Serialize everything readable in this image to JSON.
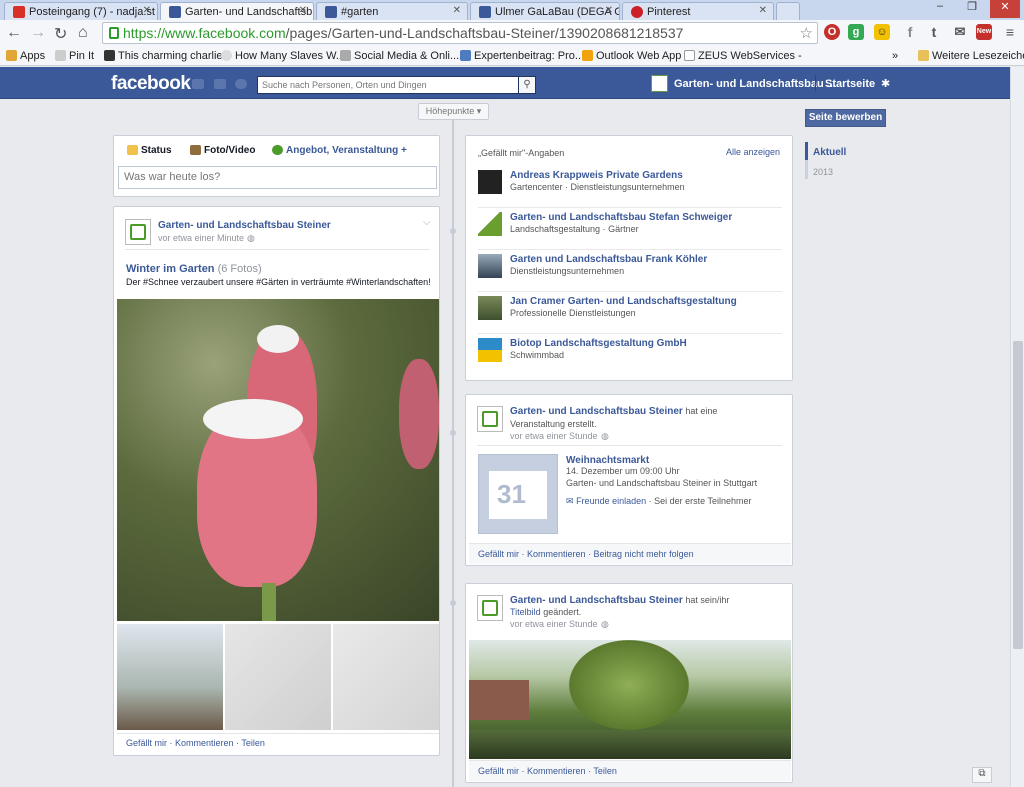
{
  "browser": {
    "tabs": [
      {
        "label": "Posteingang (7) - nadja.st",
        "icon": "gmail-icon",
        "color": "#d93025"
      },
      {
        "label": "Garten- und Landschaftsb",
        "icon": "facebook-icon",
        "color": "#3b5998"
      },
      {
        "label": "#garten",
        "icon": "facebook-icon",
        "color": "#3b5998"
      },
      {
        "label": "Ulmer GaLaBau (DEGA GA",
        "icon": "facebook-icon",
        "color": "#3b5998"
      },
      {
        "label": "Pinterest",
        "icon": "pinterest-icon",
        "color": "#cb2027"
      }
    ],
    "url_host": "https://www.facebook.com",
    "url_path": "/pages/Garten-und-Landschaftsbau-Steiner/1390208681218537",
    "bookmarks": [
      {
        "label": "Apps",
        "icon": "apps-icon"
      },
      {
        "label": "Pin It",
        "icon": "pinit-icon"
      },
      {
        "label": "This charming charlie",
        "icon": "page-icon"
      },
      {
        "label": "How Many Slaves W...",
        "icon": "page-icon"
      },
      {
        "label": "Social Media & Onli...",
        "icon": "page-icon"
      },
      {
        "label": "Expertenbeitrag: Pro...",
        "icon": "page-icon"
      },
      {
        "label": "Outlook Web App",
        "icon": "outlook-icon"
      },
      {
        "label": "ZEUS WebServices -",
        "icon": "page-icon"
      }
    ],
    "bookmarks_overflow": "»",
    "other_bookmarks": "Weitere Lesezeichen"
  },
  "fb": {
    "logo": "facebook",
    "search_placeholder": "Suche nach Personen, Orten und Dingen",
    "page_name": "Garten- und Landschaftsbau ...",
    "home": "Startseite",
    "highlights": "Höhepunkte ▾",
    "promote": "Seite bewerben",
    "years": {
      "current": "Aktuell",
      "year": "2013"
    }
  },
  "composer": {
    "tabs": [
      "Status",
      "Foto/Video",
      "Angebot, Veranstaltung +"
    ],
    "placeholder": "Was war heute los?"
  },
  "post1": {
    "author": "Garten- und Landschaftsbau Steiner",
    "time": "vor etwa einer Minute",
    "album_title": "Winter im Garten",
    "album_count": "(6 Fotos)",
    "caption": "Der #Schnee verzaubert unsere #Gärten in verträumte #Winterlandschaften!",
    "actions": [
      "Gefällt mir",
      "Kommentieren",
      "Teilen"
    ]
  },
  "likes": {
    "title": "„Gefällt mir\"-Angaben",
    "see_all": "Alle anzeigen",
    "items": [
      {
        "name": "Andreas Krappweis Private Gardens",
        "sub": "Gartencenter · Dienstleistungsunternehmen"
      },
      {
        "name": "Garten- und Landschaftsbau Stefan Schweiger",
        "sub": "Landschaftsgestaltung · Gärtner"
      },
      {
        "name": "Garten und Landschaftsbau Frank Köhler",
        "sub": "Dienstleistungsunternehmen"
      },
      {
        "name": "Jan Cramer Garten- und Landschaftsgestaltung",
        "sub": "Professionelle Dienstleistungen"
      },
      {
        "name": "Biotop Landschaftsgestaltung GmbH",
        "sub": "Schwimmbad"
      }
    ]
  },
  "event": {
    "author": "Garten- und Landschaftsbau Steiner",
    "verb": "hat eine",
    "verb2": "Veranstaltung erstellt.",
    "time": "vor etwa einer Stunde",
    "day": "31",
    "title": "Weihnachtsmarkt",
    "date": "14. Dezember um 09:00 Uhr",
    "where": "Garten- und Landschaftsbau Steiner in Stuttgart",
    "invite": "Freunde einladen",
    "first": "· Sei der erste Teilnehmer",
    "actions": [
      "Gefällt mir",
      "Kommentieren",
      "Beitrag nicht mehr folgen"
    ]
  },
  "cover": {
    "author": "Garten- und Landschaftsbau Steiner",
    "verb": "hat sein/ihr",
    "verb2": "Titelbild",
    "verb3": "geändert.",
    "time": "vor etwa einer Stunde",
    "actions": [
      "Gefällt mir",
      "Kommentieren",
      "Teilen"
    ]
  }
}
